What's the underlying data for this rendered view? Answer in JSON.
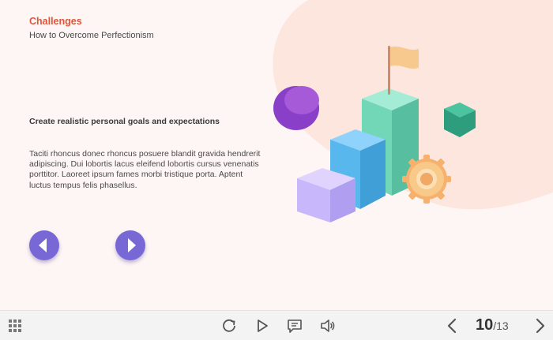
{
  "slide": {
    "heading": "Challenges",
    "subheading": "How to Overcome Perfectionism",
    "goal": "Create realistic personal goals and expectations",
    "body": "Taciti rhoncus donec rhoncus posuere blandit gravida hendrerit adipiscing. Dui lobortis lacus eleifend lobortis cursus venenatis porttitor. Laoreet ipsum fames morbi tristique porta. Aptent luctus tempus felis phasellus."
  },
  "toolbar": {
    "current_page": "10",
    "total_pages": "/13"
  },
  "colors": {
    "accent": "#e0553a",
    "nav_button": "#7868d6",
    "blob": "#fde4dc"
  }
}
